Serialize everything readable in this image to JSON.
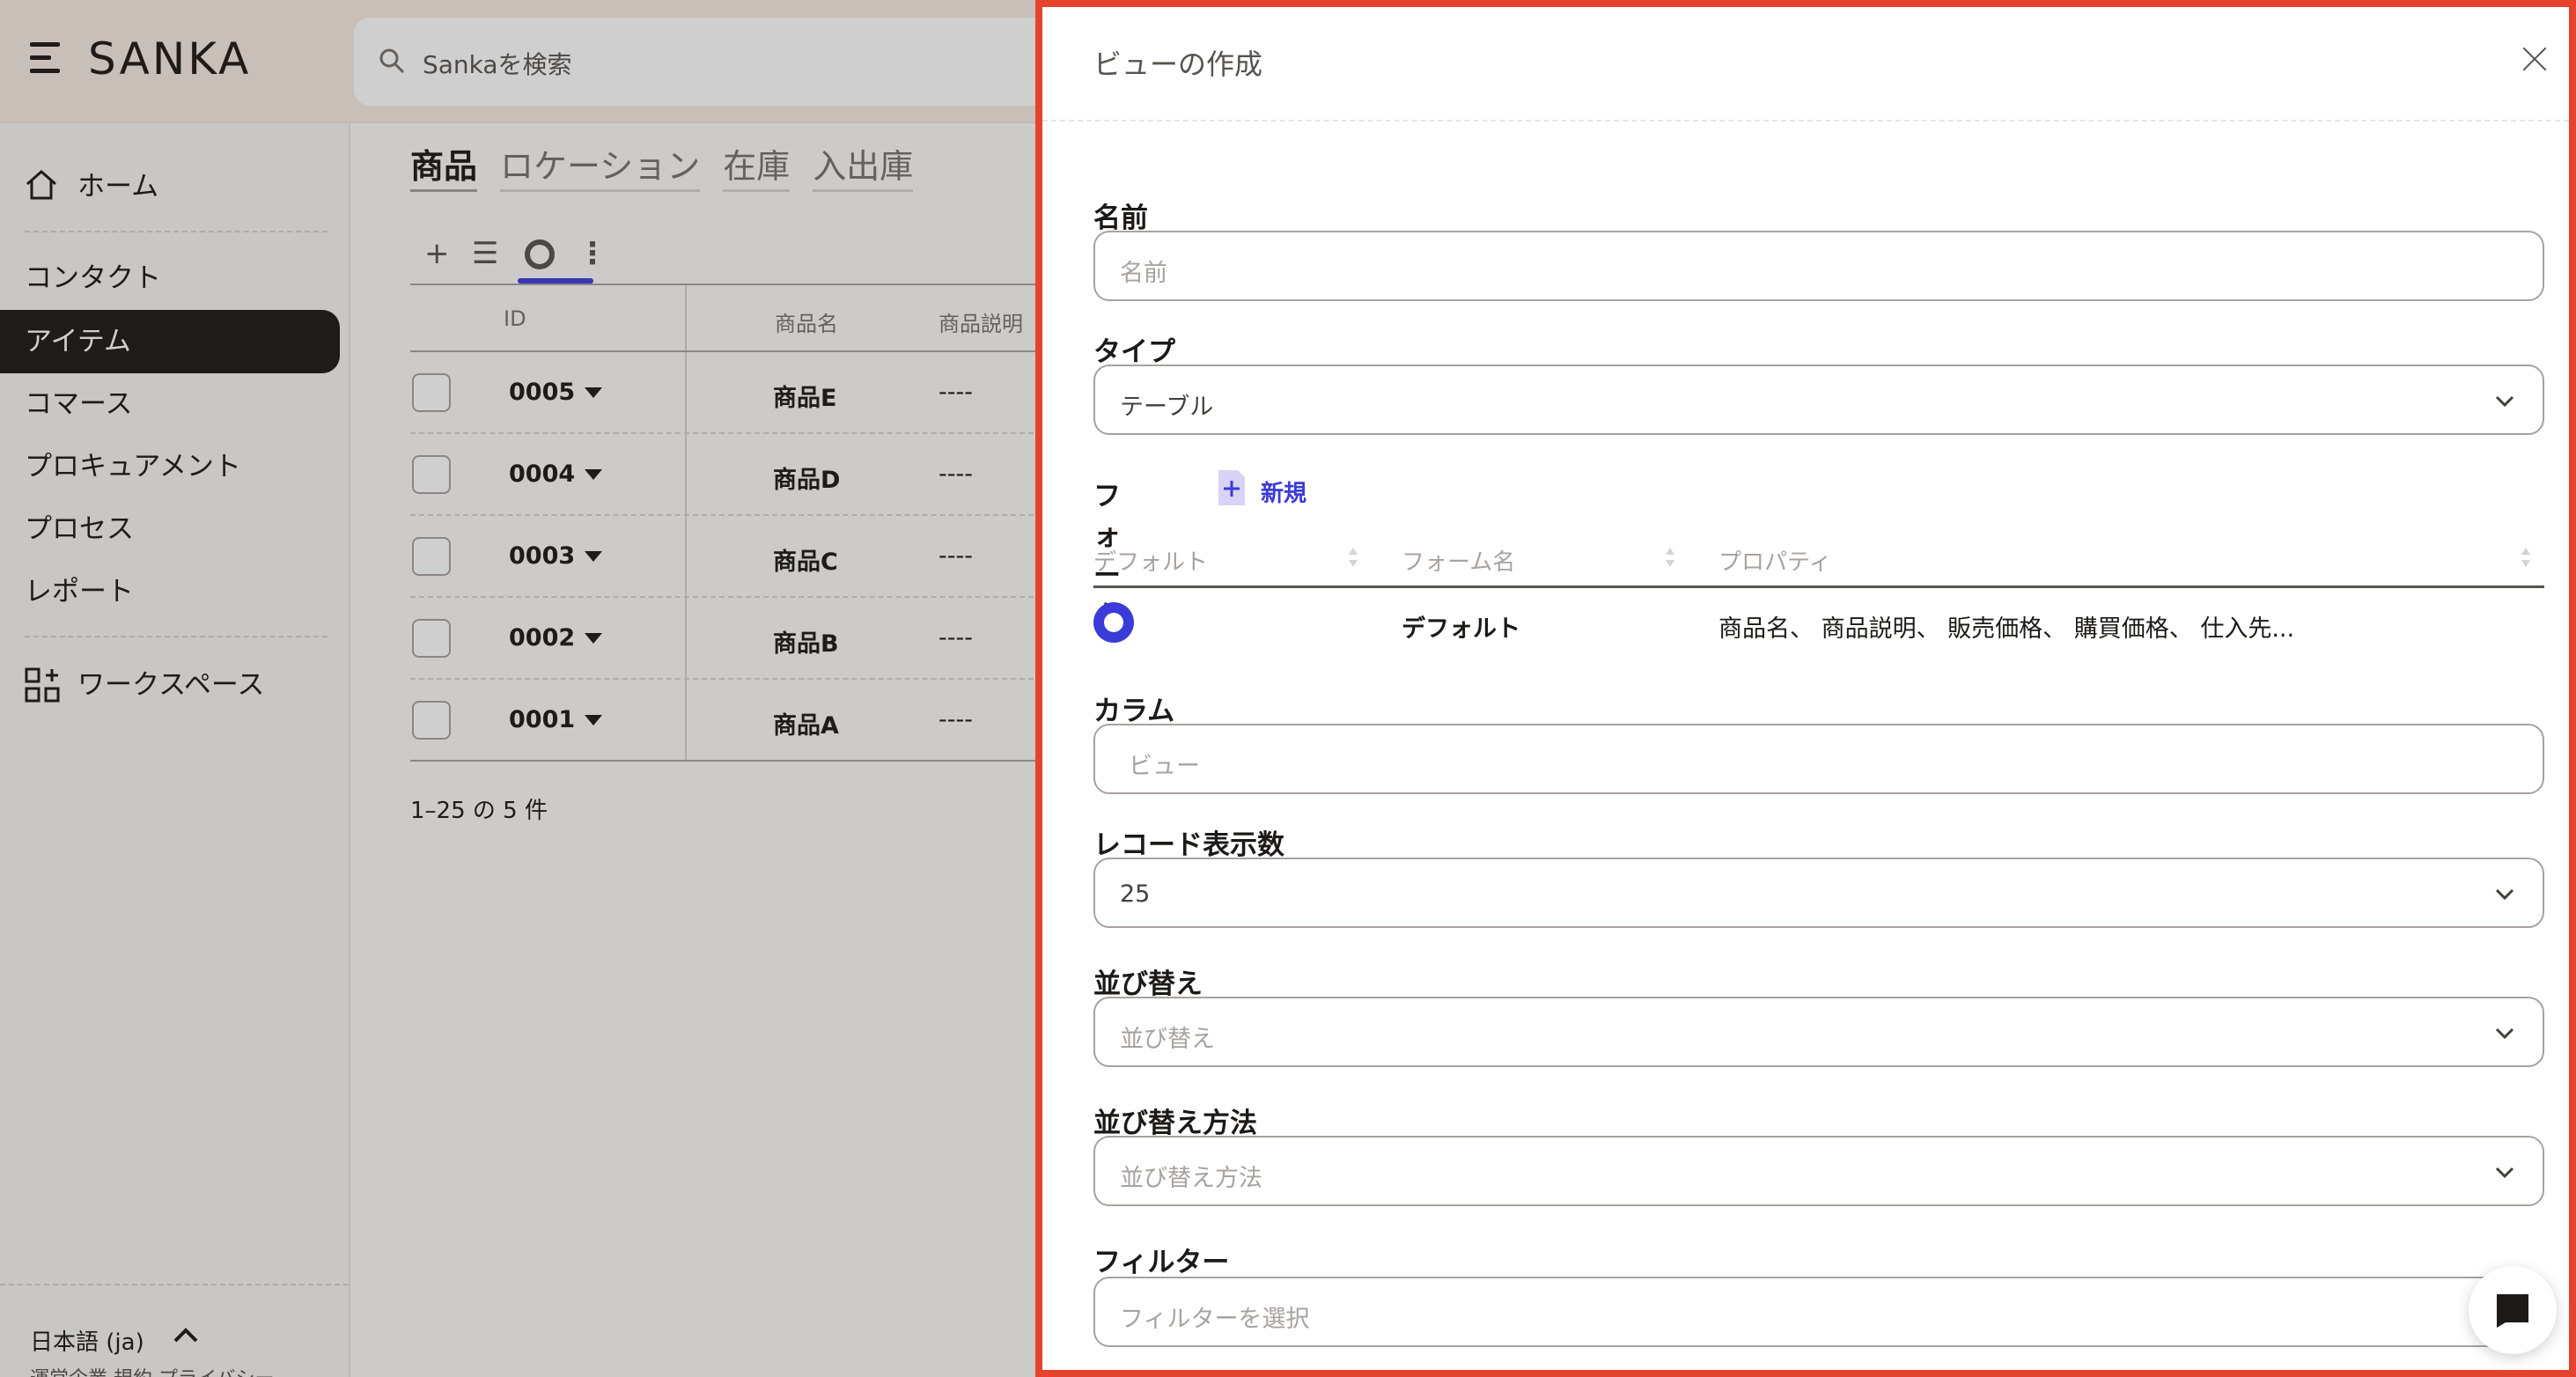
{
  "app": {
    "logo": "SANKA",
    "search_placeholder": "Sankaを検索"
  },
  "sidebar": {
    "home": "ホーム",
    "items": [
      "コンタクト",
      "アイテム",
      "コマース",
      "プロキュアメント",
      "プロセス",
      "レポート"
    ],
    "active_item": "アイテム",
    "workspace": "ワークスペース",
    "language": "日本語 (ja)",
    "footer_links": "運営企業 規約 プライバシー"
  },
  "main": {
    "tabs": [
      {
        "label": "商品",
        "active": true
      },
      {
        "label": "ロケーション",
        "active": false
      },
      {
        "label": "在庫",
        "active": false
      },
      {
        "label": "入出庫",
        "active": false
      }
    ],
    "toolbar": {
      "add": "+",
      "list": "☰",
      "more": "⋮"
    },
    "table": {
      "headers": [
        "ID",
        "商品名",
        "商品説明"
      ],
      "rows": [
        {
          "id": "0005",
          "name": "商品E",
          "desc": "----"
        },
        {
          "id": "0004",
          "name": "商品D",
          "desc": "----"
        },
        {
          "id": "0003",
          "name": "商品C",
          "desc": "----"
        },
        {
          "id": "0002",
          "name": "商品B",
          "desc": "----"
        },
        {
          "id": "0001",
          "name": "商品A",
          "desc": "----"
        }
      ]
    },
    "count": "1–25 の 5 件"
  },
  "drawer": {
    "title": "ビューの作成",
    "name": {
      "label": "名前",
      "placeholder": "名前"
    },
    "type": {
      "label": "タイプ",
      "value": "テーブル"
    },
    "form": {
      "label": "フォーム",
      "new_label": "新規",
      "headers": [
        "デフォルト",
        "フォーム名",
        "プロパティ"
      ],
      "rows": [
        {
          "name": "デフォルト",
          "properties": "商品名、 商品説明、 販売価格、 購買価格、 仕入先..."
        }
      ]
    },
    "columns": {
      "label": "カラム",
      "placeholder": "ビュー"
    },
    "records": {
      "label": "レコード表示数",
      "value": "25"
    },
    "sort": {
      "label": "並び替え",
      "placeholder": "並び替え"
    },
    "sort_method": {
      "label": "並び替え方法",
      "placeholder": "並び替え方法"
    },
    "filter": {
      "label": "フィルター",
      "placeholder": "フィルターを選択"
    }
  },
  "colors": {
    "accent": "#3b3bd9",
    "drawer_border": "#e5432e",
    "active_nav": "#1c1917"
  }
}
